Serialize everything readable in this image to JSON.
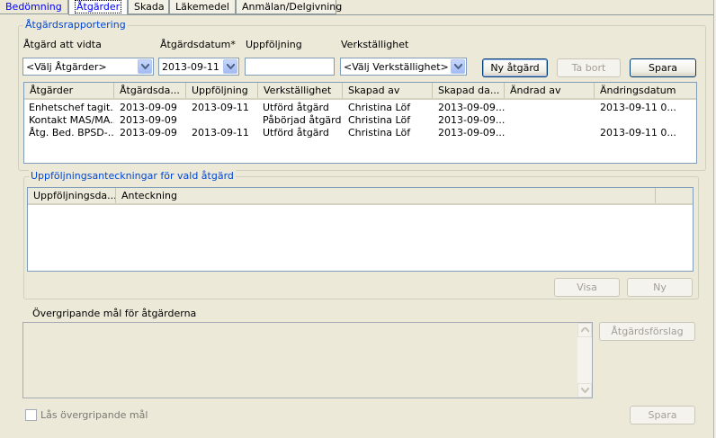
{
  "tabs": [
    {
      "label": "Bedömning"
    },
    {
      "label": "Åtgärder"
    },
    {
      "label": "Skada"
    },
    {
      "label": "Läkemedel"
    },
    {
      "label": "Anmälan/Delgivning"
    }
  ],
  "report": {
    "legend": "Åtgärdsrapportering",
    "labels": {
      "action": "Åtgärd att vidta",
      "date": "Åtgärdsdatum*",
      "followup": "Uppföljning",
      "execution": "Verkställighet"
    },
    "action_value": "<Välj Åtgärder>",
    "date_value": "2013-09-11",
    "followup_value": "",
    "execution_value": "<Välj Verkställighet>",
    "buttons": {
      "new": "Ny åtgärd",
      "remove": "Ta bort",
      "save": "Spara"
    },
    "columns": [
      "Åtgärder",
      "Åtgärdsda...",
      "Uppföljning",
      "Verkställighet",
      "Skapad av",
      "Skapad da...",
      "Ändrad av",
      "Ändringsdatum"
    ],
    "rows": [
      [
        "Enhetschef tagit...",
        "2013-09-09",
        "2013-09-11",
        "Utförd åtgärd",
        "Christina Löf",
        "2013-09-09...",
        "",
        "2013-09-11 0..."
      ],
      [
        "Kontakt MAS/MA...",
        "2013-09-09",
        "",
        "Påbörjad åtgärd",
        "Christina Löf",
        "2013-09-09...",
        "",
        ""
      ],
      [
        "Åtg. Bed. BPSD-...",
        "2013-09-09",
        "2013-09-11",
        "Utförd åtgärd",
        "Christina Löf",
        "2013-09-09...",
        "",
        "2013-09-11 0..."
      ]
    ]
  },
  "notes": {
    "legend": "Uppföljningsanteckningar för vald åtgärd",
    "columns": [
      "Uppföljningsda...",
      "Anteckning"
    ],
    "buttons": {
      "show": "Visa",
      "new": "Ny"
    }
  },
  "goals": {
    "legend": "Övergripande mål för åtgärderna",
    "suggest_button": "Åtgärdsförslag",
    "lock_label": "Lås övergripande mål",
    "save_button": "Spara"
  }
}
